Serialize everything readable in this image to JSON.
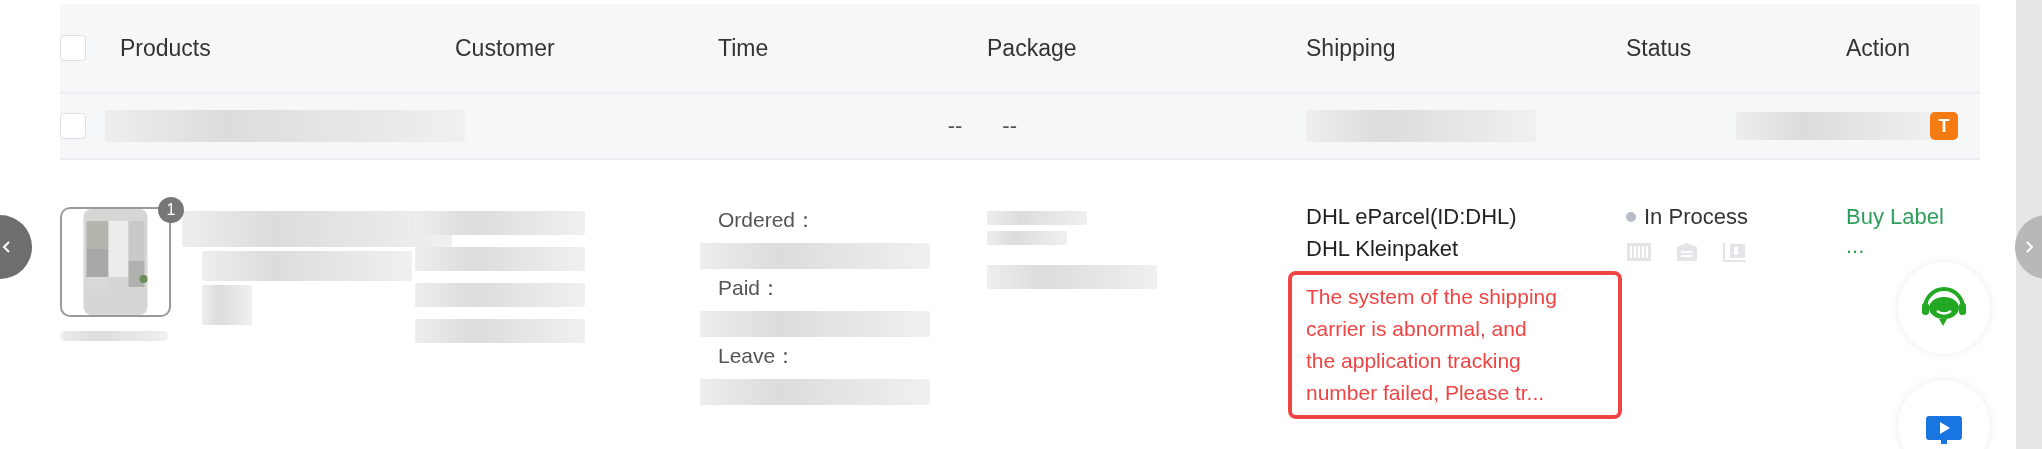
{
  "table": {
    "select_all": {
      "checked": false
    },
    "columns": [
      "Products",
      "Customer",
      "Time",
      "Package",
      "Shipping",
      "Status",
      "Action"
    ],
    "group_row": {
      "checked": false,
      "time_placeholders": [
        "--",
        "--"
      ],
      "badge": "T"
    },
    "rows": [
      {
        "quantity": "1",
        "time_labels": [
          "Ordered：",
          "Paid：",
          "Leave："
        ],
        "shipping_lines": [
          "DHL eParcel(ID:DHL)",
          "DHL Kleinpaket"
        ],
        "error": "The system of the shipping carrier is abnormal, and the application tracking number failed, Please tr...",
        "status": {
          "text": "In Process",
          "color": "#b8bcc4"
        },
        "actions": [
          {
            "kind": "link",
            "label": "Buy Label"
          },
          {
            "kind": "more",
            "label": "..."
          }
        ]
      }
    ]
  }
}
